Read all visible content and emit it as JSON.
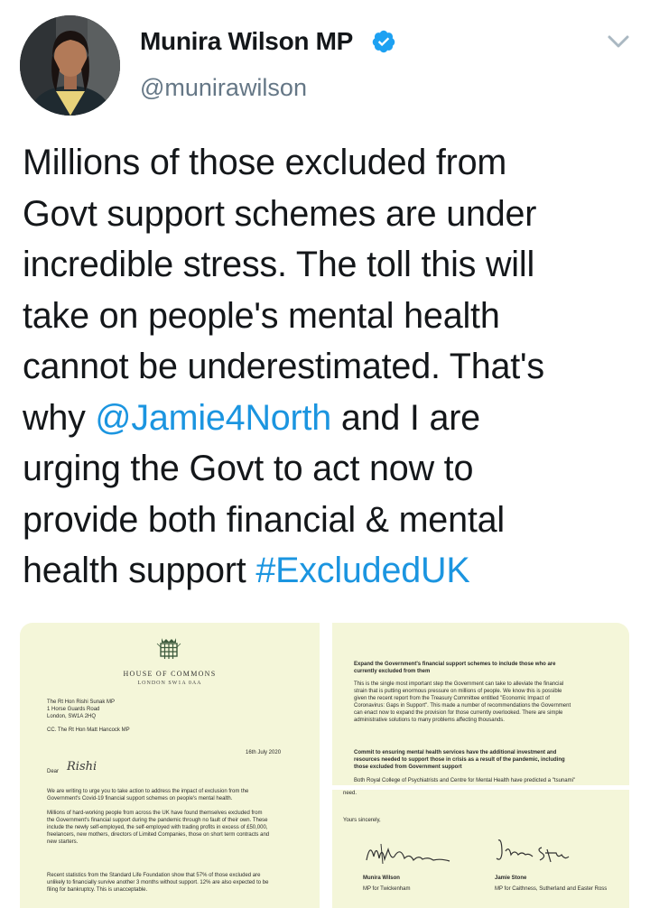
{
  "tweet": {
    "author": {
      "display_name": "Munira Wilson MP",
      "handle": "@munirawilson",
      "verified": true
    },
    "text_lines": [
      {
        "parts": [
          {
            "t": "Millions of those excluded from",
            "link": false
          }
        ]
      },
      {
        "parts": [
          {
            "t": "Govt support schemes are under",
            "link": false
          }
        ]
      },
      {
        "parts": [
          {
            "t": "incredible stress. The toll this will",
            "link": false
          }
        ]
      },
      {
        "parts": [
          {
            "t": "take on people's mental health",
            "link": false
          }
        ]
      },
      {
        "parts": [
          {
            "t": "cannot be underestimated. That's",
            "link": false
          }
        ]
      },
      {
        "parts": [
          {
            "t": "why ",
            "link": false
          },
          {
            "t": "@Jamie4North",
            "link": true
          },
          {
            "t": " and I are",
            "link": false
          }
        ]
      },
      {
        "parts": [
          {
            "t": "urging the Govt to act now to",
            "link": false
          }
        ]
      },
      {
        "parts": [
          {
            "t": "provide both financial & mental",
            "link": false
          }
        ]
      },
      {
        "parts": [
          {
            "t": "health support ",
            "link": false
          },
          {
            "t": "#ExcludedUK",
            "link": true
          }
        ]
      }
    ],
    "colors": {
      "text": "#14171a",
      "secondary": "#657786",
      "link": "#1b95e0",
      "verified_badge": "#1da1f2",
      "letter_paper": "#f4f6d9"
    }
  },
  "letter_page_1": {
    "house": "HOUSE OF COMMONS",
    "house_address": "LONDON SW1A 0AA",
    "recipient": [
      "The Rt Hon Rishi Sunak MP",
      "1 Horse Guards Road",
      "London, SW1A 2HQ"
    ],
    "cc": "CC. The Rt Hon Matt Hancock MP",
    "date": "16th July 2020",
    "salutation": "Dear",
    "salutation_name": "Rishi",
    "paragraphs": [
      [
        "We are writing to urge you to take action to address the impact of exclusion from the",
        "Government's Covid-19 financial support schemes on people's mental health."
      ],
      [
        "Millions of hard-working people from across the UK have found themselves excluded from",
        "the Government's financial support during the pandemic through no fault of their own. These",
        "include the newly self-employed, the self-employed with trading profits in excess of £50,000,",
        "freelancers, new mothers, directors of Limited Companies, those on short term contracts and",
        "new starters."
      ],
      [
        "Recent statistics from the Standard Life Foundation show that 57% of those excluded are",
        "unlikely to financially survive another 3 months without support. 12% are also expected to be",
        "filing for bankruptcy. This is unacceptable."
      ]
    ]
  },
  "letter_page_2": {
    "heading_1": [
      "Expand the Government's financial support schemes to include those who are",
      "currently excluded from them"
    ],
    "body_1": [
      "This is the single most important step the Government can take to alleviate the financial",
      "strain that is putting enormous pressure on millions of people. We know this is possible",
      "given the recent report from the Treasury Committee entitled \"Economic Impact of",
      "Coronavirus: Gaps in Support\". This made a number of recommendations the Government",
      "can enact now to expand the provision for those currently overlooked. There are simple",
      "administrative solutions to many problems affecting thousands."
    ],
    "heading_2": [
      "Commit to ensuring mental health services have the additional investment and",
      "resources needed to support those in crisis as a result of the pandemic, including",
      "those excluded from Government support"
    ],
    "body_2": [
      "Both Royal College of Psychiatrists and Centre for Mental Health have predicted a \"tsunami\""
    ]
  },
  "letter_page_3": {
    "top_fragment": "need.",
    "closing": "Yours sincerely,",
    "signatories": [
      {
        "name": "Munira Wilson",
        "role": "MP for Twickenham"
      },
      {
        "name": "Jamie Stone",
        "role": "MP for Caithness, Sutherland and Easter Ross"
      }
    ]
  }
}
